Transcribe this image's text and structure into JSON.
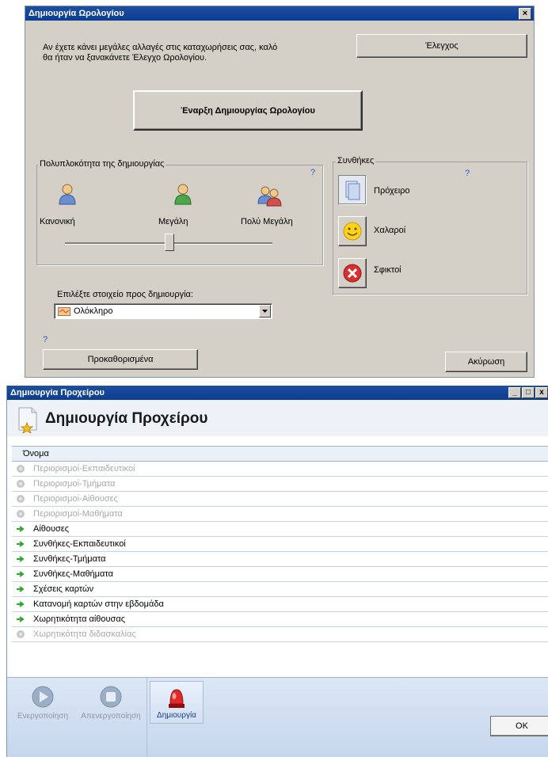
{
  "win1": {
    "title": "Δημιουργία Ωρολογίου",
    "close": "×",
    "info_line1": "Αν έχετε κάνει μεγάλες αλλαγές στις καταχωρήσεις σας, καλό",
    "info_line2": "θα ήταν να ξανακάνετε Έλεγχο Ωρολογίου.",
    "check_button": "Έλεγχος",
    "start_button": "Έναρξη Δημιουργίας Ωρολογίου",
    "complexity": {
      "label": "Πολυπλοκότητα της δημιουργίας",
      "help": "?",
      "options": [
        "Κανονική",
        "Μεγάλη",
        "Πολύ Μεγάλη"
      ],
      "slider_level": 0.5
    },
    "conditions": {
      "label": "Συνθήκες",
      "help": "?",
      "options": [
        "Πρόχειρο",
        "Χαλαροί",
        "Σφικτοί"
      ]
    },
    "select": {
      "label": "Επιλέξτε στοιχείο προς δημιουργία:",
      "value": "Ολόκληρο"
    },
    "help": "?",
    "defaults_button": "Προκαθορισμένα",
    "cancel_button": "Ακύρωση"
  },
  "win2": {
    "title": "Δημιουργία Προχείρου",
    "header": "Δημιουργία Προχείρου",
    "column": "Όνομα",
    "rows": [
      {
        "label": "Περιορισμοί-Εκπαιδευτικοί",
        "enabled": false
      },
      {
        "label": "Περιορισμοί-Τμήματα",
        "enabled": false
      },
      {
        "label": "Περιορισμοί-Αίθουσες",
        "enabled": false
      },
      {
        "label": "Περιορισμοί-Μαθήματα",
        "enabled": false
      },
      {
        "label": "Αίθουσες",
        "enabled": true
      },
      {
        "label": "Συνθήκες-Εκπαιδευτικοί",
        "enabled": true
      },
      {
        "label": "Συνθήκες-Τμήματα",
        "enabled": true
      },
      {
        "label": "Συνθήκες-Μαθήματα",
        "enabled": true
      },
      {
        "label": "Σχέσεις καρτών",
        "enabled": true
      },
      {
        "label": "Κατανομή καρτών στην εβδομάδα",
        "enabled": true
      },
      {
        "label": "Χωρητικότητα αίθουσας",
        "enabled": true
      },
      {
        "label": "Χωρητικότητα διδασκαλίας",
        "enabled": false
      }
    ],
    "tools": [
      "Ενεργοποίηση",
      "Απενεργοποίηση",
      "Δημιουργία"
    ],
    "ok_button": "OK",
    "ctrl": [
      "_",
      "□",
      "x"
    ]
  }
}
